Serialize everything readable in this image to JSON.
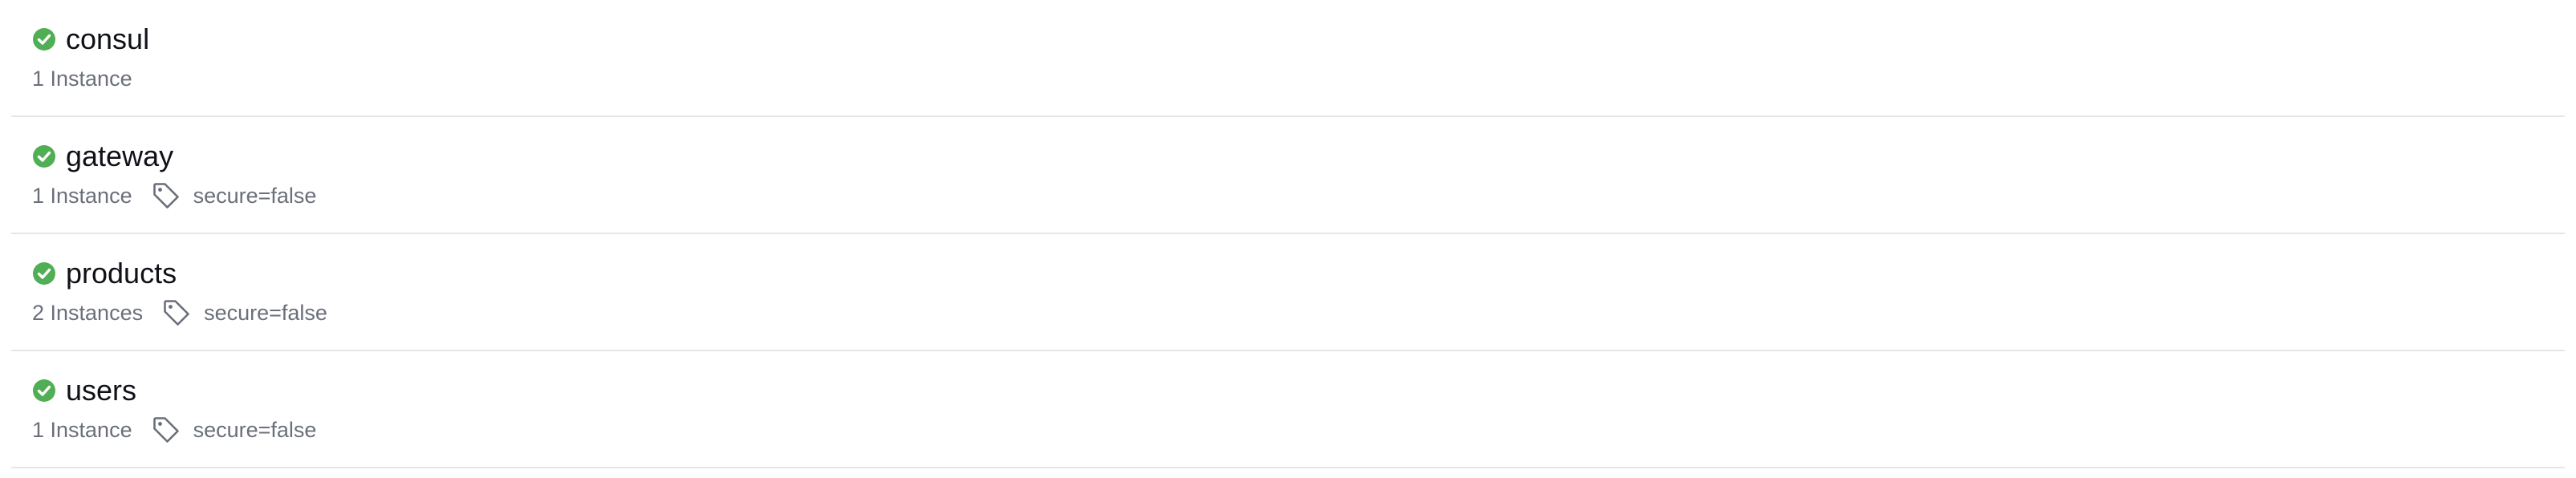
{
  "colors": {
    "health_passing": "#50ae54",
    "name_text": "#0f1117",
    "meta_text": "#6a6f7a",
    "divider": "#e4e5e8"
  },
  "icons": {
    "health": "check-circle-icon",
    "tag": "tag-icon"
  },
  "services": [
    {
      "name": "consul",
      "status": "passing",
      "instances": "1 Instance",
      "tags": []
    },
    {
      "name": "gateway",
      "status": "passing",
      "instances": "1 Instance",
      "tags": [
        "secure=false"
      ]
    },
    {
      "name": "products",
      "status": "passing",
      "instances": "2 Instances",
      "tags": [
        "secure=false"
      ]
    },
    {
      "name": "users",
      "status": "passing",
      "instances": "1 Instance",
      "tags": [
        "secure=false"
      ]
    }
  ]
}
